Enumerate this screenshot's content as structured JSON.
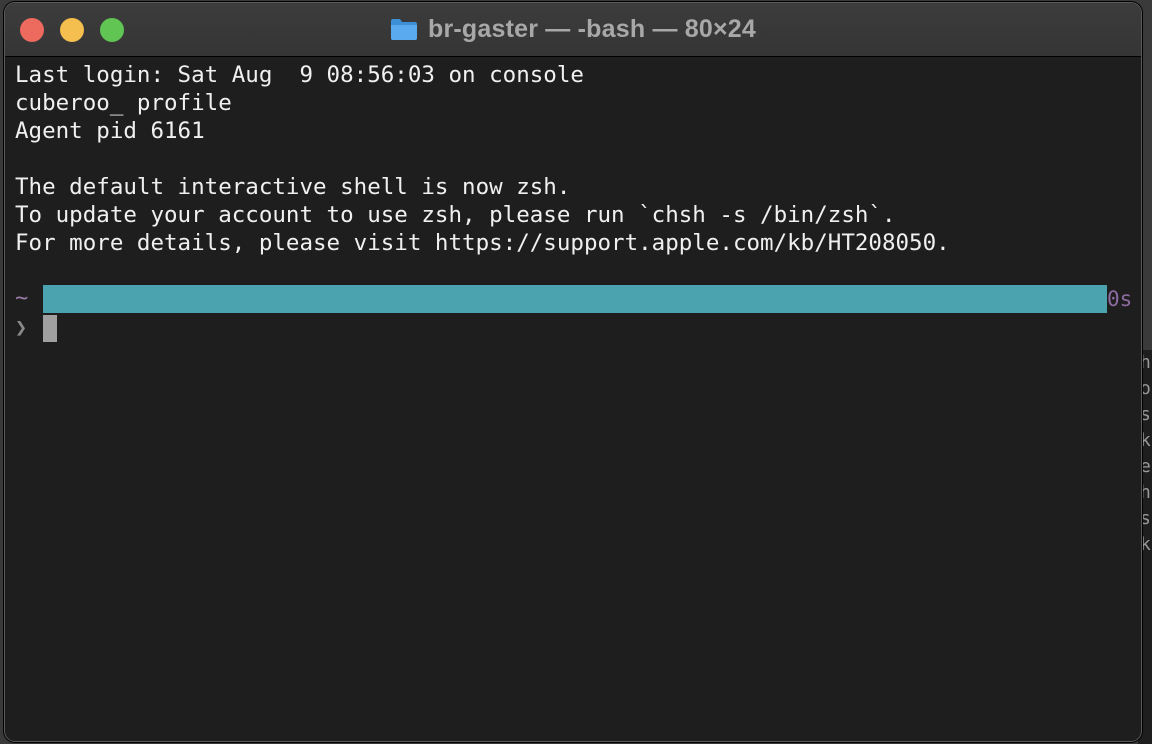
{
  "window": {
    "title": "br-gaster — -bash — 80×24",
    "folder_icon": "folder-icon"
  },
  "terminal": {
    "lines": [
      "Last login: Sat Aug  9 08:56:03 on console",
      "cuberoo_ profile",
      "Agent pid 6161",
      "",
      "The default interactive shell is now zsh.",
      "To update your account to use zsh, please run `chsh -s /bin/zsh`.",
      "For more details, please visit https://support.apple.com/kb/HT208050."
    ],
    "prompt_dir": "~",
    "prompt_duration": "0s",
    "prompt_symbol": "❯"
  },
  "background_window": {
    "fragments": [
      "",
      "h",
      "o",
      "",
      "s",
      "k",
      "e",
      "",
      "",
      "h",
      "",
      "",
      "",
      "s",
      "k"
    ]
  },
  "colors": {
    "prompt_bar": "#4ba3b0",
    "prompt_accent": "#9a7ba8",
    "text": "#f0f0f0",
    "background": "#1e1e1e"
  }
}
